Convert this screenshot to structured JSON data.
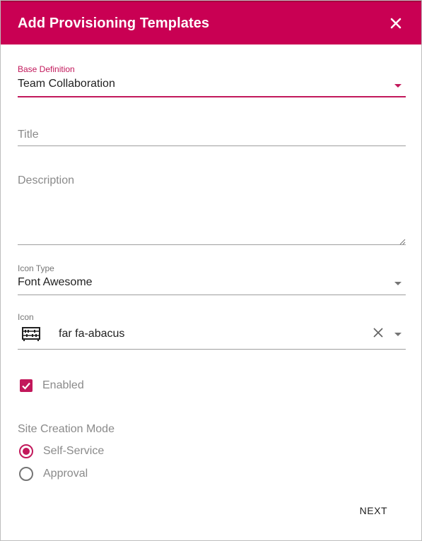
{
  "dialog": {
    "title": "Add Provisioning Templates",
    "header_color": "#c90053",
    "close_icon": "close-icon"
  },
  "form": {
    "base_definition": {
      "label": "Base Definition",
      "value": "Team Collaboration"
    },
    "title": {
      "placeholder": "Title",
      "value": ""
    },
    "description": {
      "placeholder": "Description",
      "value": ""
    },
    "icon_type": {
      "label": "Icon Type",
      "value": "Font Awesome"
    },
    "icon": {
      "label": "Icon",
      "value": "far fa-abacus",
      "preview_icon": "abacus-icon",
      "clear_icon": "clear-icon"
    },
    "enabled": {
      "label": "Enabled",
      "checked": true
    },
    "site_creation_mode": {
      "label": "Site Creation Mode",
      "options": [
        {
          "label": "Self-Service",
          "checked": true
        },
        {
          "label": "Approval",
          "checked": false
        }
      ]
    }
  },
  "footer": {
    "next_label": "NEXT"
  },
  "colors": {
    "accent": "#c2185b"
  }
}
